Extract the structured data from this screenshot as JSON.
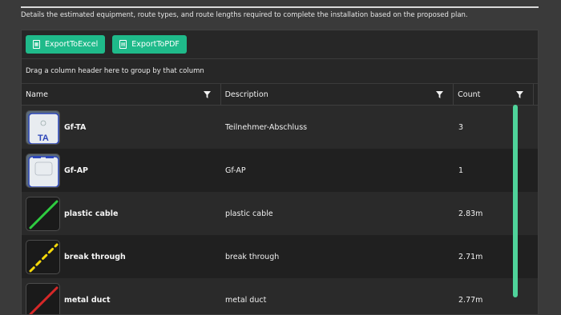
{
  "intro": "Details the estimated equipment, route types, and route lengths required to complete the installation based on the proposed plan.",
  "toolbar": {
    "export_excel": "ExportToExcel",
    "export_pdf": "ExportToPDF"
  },
  "group_hint": "Drag a column header here to group by that column",
  "columns": [
    "Name",
    "Description",
    "Count"
  ],
  "rows": [
    {
      "name": "Gf-TA",
      "description": "Teilnehmer-Abschluss",
      "count": "3",
      "icon": "gf-ta-device-icon"
    },
    {
      "name": "Gf-AP",
      "description": "Gf-AP",
      "count": "1",
      "icon": "gf-ap-device-icon"
    },
    {
      "name": "plastic cable",
      "description": "plastic cable",
      "count": "2.83m",
      "icon": "green-line-icon"
    },
    {
      "name": "break through",
      "description": "break through",
      "count": "2.71m",
      "icon": "yellow-dashed-line-icon"
    },
    {
      "name": "metal duct",
      "description": "metal duct",
      "count": "2.77m",
      "icon": "red-line-icon"
    }
  ],
  "colors": {
    "accent": "#1fba8a",
    "scrollbar": "#4fd39a",
    "green_line": "#2ecc40",
    "yellow_line": "#f5d90a",
    "red_line": "#d62828"
  }
}
